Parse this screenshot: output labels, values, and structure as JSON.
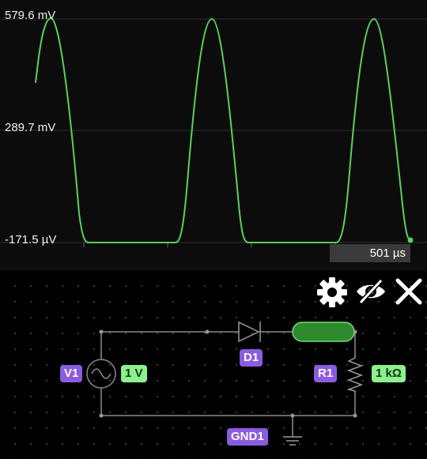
{
  "scope": {
    "y_labels": {
      "top": "579.6 mV",
      "mid": "289.7 mV",
      "bottom": "-171.5 µV"
    },
    "time_label": "501 µs",
    "trace_color": "#5ad05a"
  },
  "toolbar": {
    "settings_icon": "gear-icon",
    "visibility_icon": "eye-off-icon",
    "close_icon": "close-icon"
  },
  "circuit": {
    "source": {
      "name": "V1",
      "value": "1 V"
    },
    "diode": {
      "name": "D1"
    },
    "resistor": {
      "name": "R1",
      "value": "1 kΩ"
    },
    "ground": {
      "name": "GND1"
    },
    "highlight_color": "#2f8a2f"
  },
  "colors": {
    "label_purple": "#8b5ce0",
    "value_green": "#8df08f",
    "wire": "#8a8a8a"
  }
}
